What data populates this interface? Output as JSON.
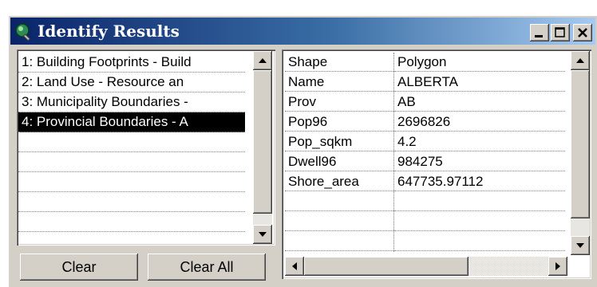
{
  "window": {
    "title": "Identify Results",
    "buttons": {
      "minimize_icon": "minimize-icon",
      "maximize_icon": "maximize-icon",
      "close_icon": "close-icon"
    }
  },
  "layers": {
    "items": [
      {
        "label": "1:  Building Footprints - Build",
        "selected": false
      },
      {
        "label": "2:  Land Use - Resource an",
        "selected": false
      },
      {
        "label": "3:  Municipality Boundaries -",
        "selected": false
      },
      {
        "label": "4:  Provincial Boundaries - A",
        "selected": true
      },
      {
        "label": "",
        "selected": false
      },
      {
        "label": "",
        "selected": false
      },
      {
        "label": "",
        "selected": false
      },
      {
        "label": "",
        "selected": false
      },
      {
        "label": "",
        "selected": false
      }
    ]
  },
  "buttons": {
    "clear": "Clear",
    "clear_all": "Clear All"
  },
  "attributes": {
    "rows": [
      {
        "field": "Shape",
        "value": "Polygon"
      },
      {
        "field": "Name",
        "value": "ALBERTA"
      },
      {
        "field": "Prov",
        "value": "AB"
      },
      {
        "field": "Pop96",
        "value": "2696826"
      },
      {
        "field": "Pop_sqkm",
        "value": "4.2"
      },
      {
        "field": "Dwell96",
        "value": "984275"
      },
      {
        "field": "Shore_area",
        "value": "647735.97112"
      },
      {
        "field": "",
        "value": ""
      },
      {
        "field": "",
        "value": ""
      },
      {
        "field": "",
        "value": ""
      }
    ]
  },
  "colors": {
    "titlebar_start": "#0a246a",
    "titlebar_end": "#a6caf0",
    "face": "#d4d0c8",
    "selection": "#000000"
  }
}
